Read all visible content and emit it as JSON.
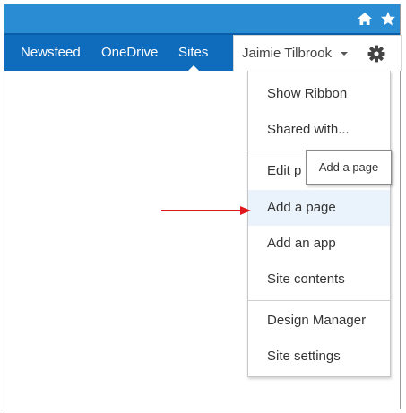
{
  "topbar": {
    "icons": [
      "home-icon",
      "star-icon"
    ],
    "color": "#2a8dd4"
  },
  "suitebar": {
    "color": "#0f6cbd",
    "links": [
      "Newsfeed",
      "OneDrive",
      "Sites"
    ],
    "active_link": "Sites",
    "user_name": "Jaimie Tilbrook",
    "settings_icon": "gear-icon"
  },
  "menu": {
    "items": [
      "Show Ribbon",
      "Shared with...",
      "Edit p",
      "Add a page",
      "Add an app",
      "Site contents",
      "Design Manager",
      "Site settings"
    ],
    "highlighted": "Add a page",
    "highlight_color": "#eaf3fb"
  },
  "tooltip": {
    "text": "Add a page"
  },
  "annotation": {
    "arrow_color": "#e0191d"
  }
}
